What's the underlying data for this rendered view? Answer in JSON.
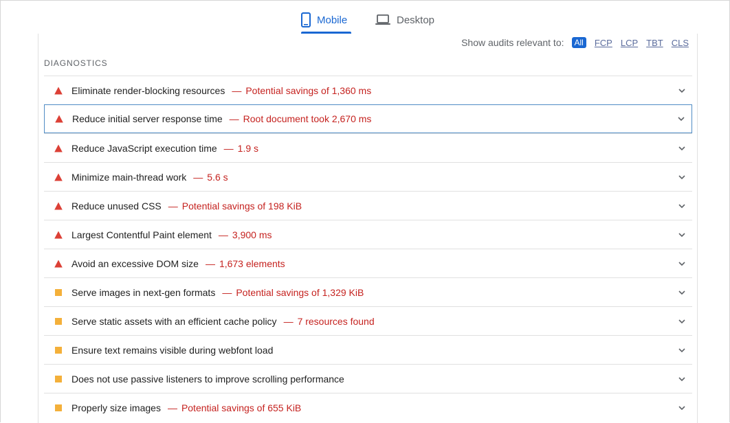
{
  "tabs": [
    {
      "label": "Mobile",
      "icon": "smartphone-icon",
      "active": true
    },
    {
      "label": "Desktop",
      "icon": "laptop-icon",
      "active": false
    }
  ],
  "filter": {
    "label": "Show audits relevant to:",
    "options": [
      "All",
      "FCP",
      "LCP",
      "TBT",
      "CLS"
    ],
    "selected": "All"
  },
  "section": {
    "title": "DIAGNOSTICS"
  },
  "audits": [
    {
      "severity": "fail",
      "title": "Eliminate render-blocking resources",
      "sep": "—",
      "detail": "Potential savings of 1,360 ms"
    },
    {
      "severity": "fail",
      "title": "Reduce initial server response time",
      "sep": "—",
      "detail": "Root document took 2,670 ms"
    },
    {
      "severity": "fail",
      "title": "Reduce JavaScript execution time",
      "sep": "—",
      "detail": "1.9 s"
    },
    {
      "severity": "fail",
      "title": "Minimize main-thread work",
      "sep": "—",
      "detail": "5.6 s"
    },
    {
      "severity": "fail",
      "title": "Reduce unused CSS",
      "sep": "—",
      "detail": "Potential savings of 198 KiB"
    },
    {
      "severity": "fail",
      "title": "Largest Contentful Paint element",
      "sep": "—",
      "detail": "3,900 ms"
    },
    {
      "severity": "fail",
      "title": "Avoid an excessive DOM size",
      "sep": "—",
      "detail": "1,673 elements"
    },
    {
      "severity": "warn",
      "title": "Serve images in next-gen formats",
      "sep": "—",
      "detail": "Potential savings of 1,329 KiB"
    },
    {
      "severity": "warn",
      "title": "Serve static assets with an efficient cache policy",
      "sep": "—",
      "detail": "7 resources found"
    },
    {
      "severity": "warn",
      "title": "Ensure text remains visible during webfont load",
      "sep": "",
      "detail": ""
    },
    {
      "severity": "warn",
      "title": "Does not use passive listeners to improve scrolling performance",
      "sep": "",
      "detail": ""
    },
    {
      "severity": "warn",
      "title": "Properly size images",
      "sep": "—",
      "detail": "Potential savings of 655 KiB"
    }
  ],
  "colors": {
    "accent": "#1967d2",
    "fail": "#c5221f",
    "warn": "#f4b03a",
    "focus_border": "#4e8bc4"
  }
}
